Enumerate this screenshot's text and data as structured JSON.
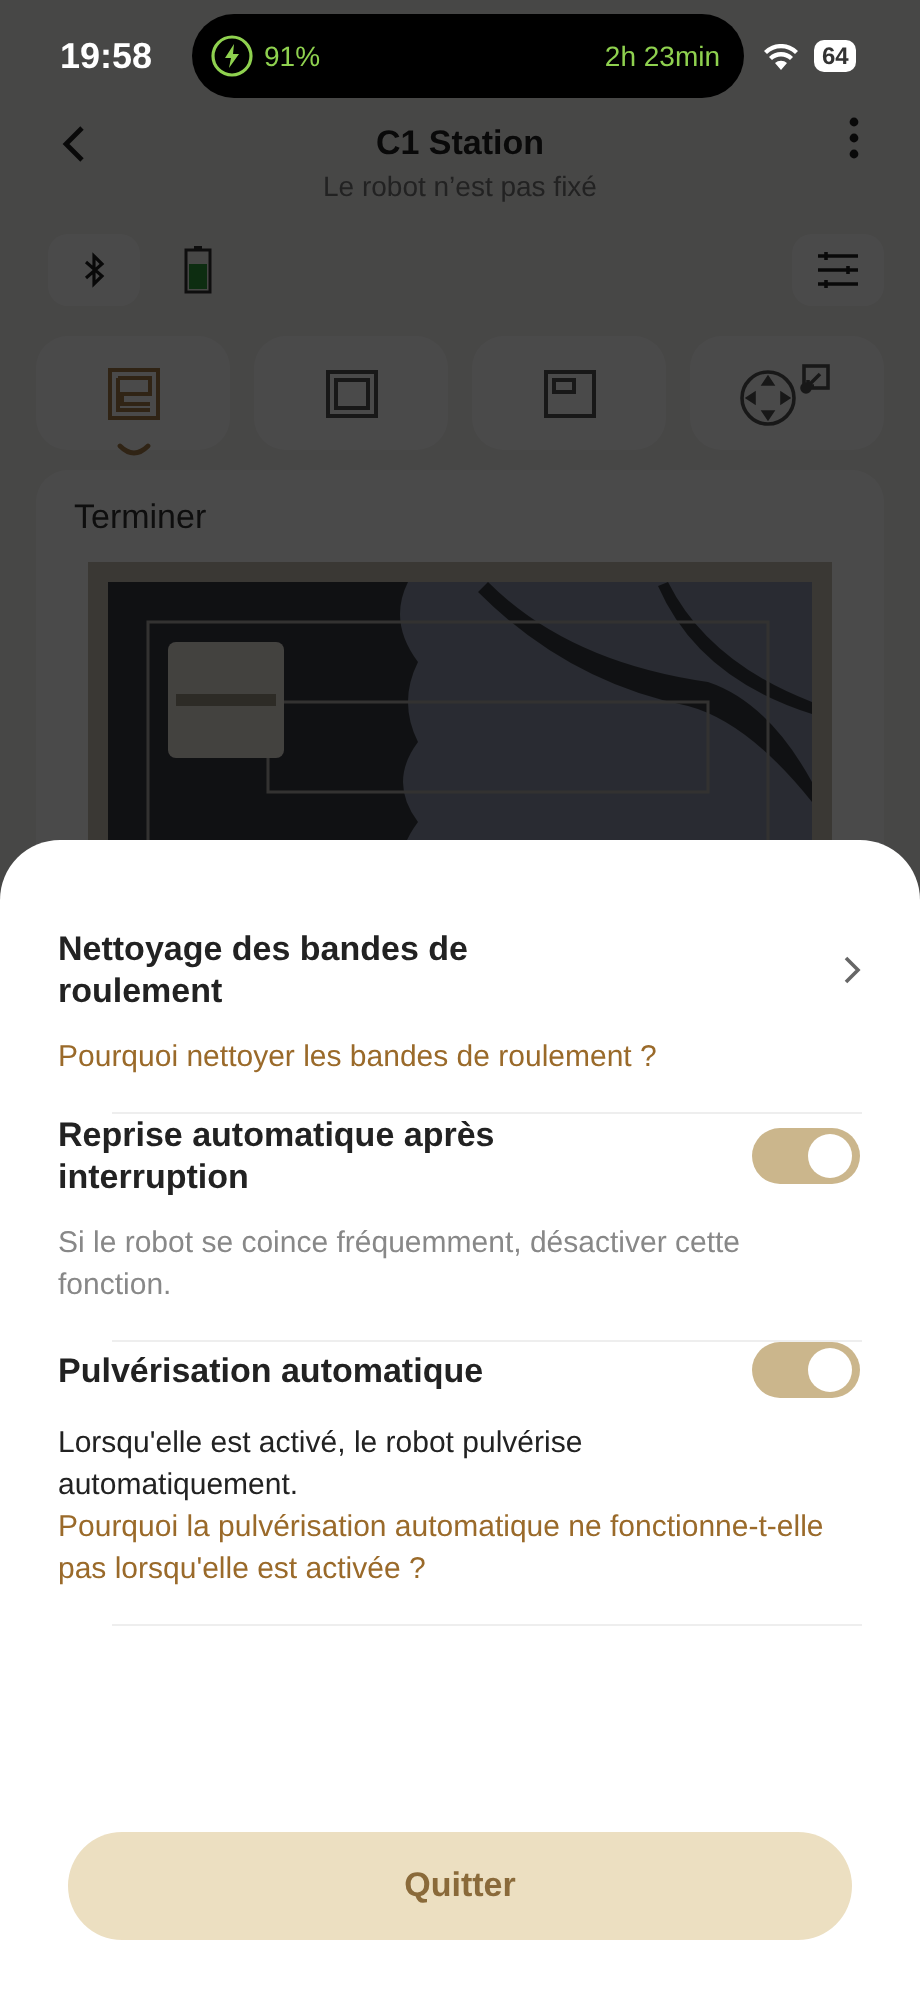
{
  "status_bar": {
    "time": "19:58",
    "charge": "91%",
    "remaining": "2h 23min",
    "battery": "64"
  },
  "header": {
    "title": "C1 Station",
    "subtitle": "Le robot n’est pas fixé"
  },
  "mode_tabs": [
    {
      "kind": "zigzag",
      "selected": true
    },
    {
      "kind": "frame",
      "selected": false
    },
    {
      "kind": "corner",
      "selected": false
    },
    {
      "kind": "joystick",
      "selected": false
    }
  ],
  "map": {
    "status": "Terminer",
    "kind": "picture"
  },
  "sheet": {
    "items": [
      {
        "kind": "link",
        "title": "Nettoyage des bandes de roulement",
        "link": "Pourquoi nettoyer les bandes de roulement ?"
      },
      {
        "kind": "toggle",
        "title": "Reprise automatique après interruption",
        "on": true,
        "description": "Si le robot se coince fréquemment, désactiver cette fonction.",
        "description_muted": true
      },
      {
        "kind": "toggle",
        "title": "Pulvérisation automatique",
        "on": true,
        "description": "Lorsqu'elle est activé, le robot pulvérise automatiquement.",
        "description_muted": false,
        "link": "Pourquoi la pulvérisation automatique ne fonctionne-t-elle pas lorsqu'elle est activée ?"
      }
    ],
    "button": "Quitter"
  }
}
